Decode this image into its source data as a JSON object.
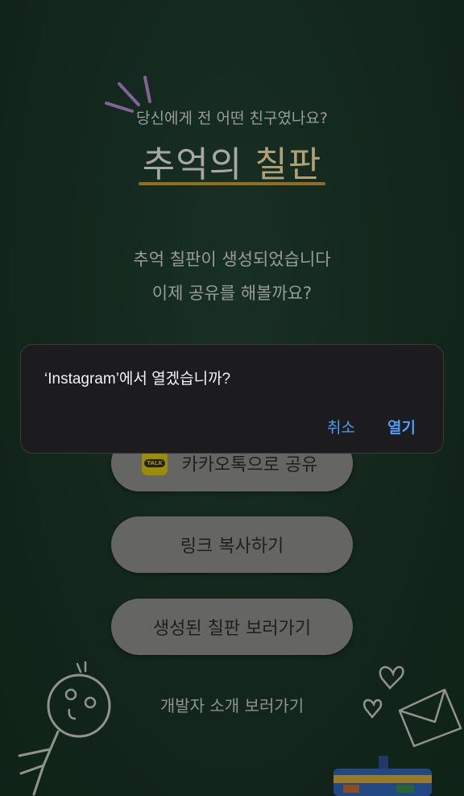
{
  "header": {
    "subtitle": "당신에게 전 어떤 친구였나요?",
    "title_main": "추억의 ",
    "title_accent": "칠판"
  },
  "message": {
    "line1": "추억 칠판이 생성되었습니다",
    "line2": "이제 공유를 해볼까요?"
  },
  "buttons": {
    "kakao_share": "카카오톡으로 공유",
    "kakao_badge": "TALK",
    "copy_link": "링크 복사하기",
    "view_board": "생성된 칠판 보러가기"
  },
  "footer": {
    "dev_intro": "개발자 소개 보러가기"
  },
  "alert": {
    "title": "‘Instagram’에서 열겠습니까?",
    "cancel": "취소",
    "open": "열기"
  },
  "colors": {
    "board": "#1e3a2c",
    "underline": "#c99a2e",
    "alert_bg": "#1c1c1e",
    "alert_button": "#4d9cf6"
  }
}
